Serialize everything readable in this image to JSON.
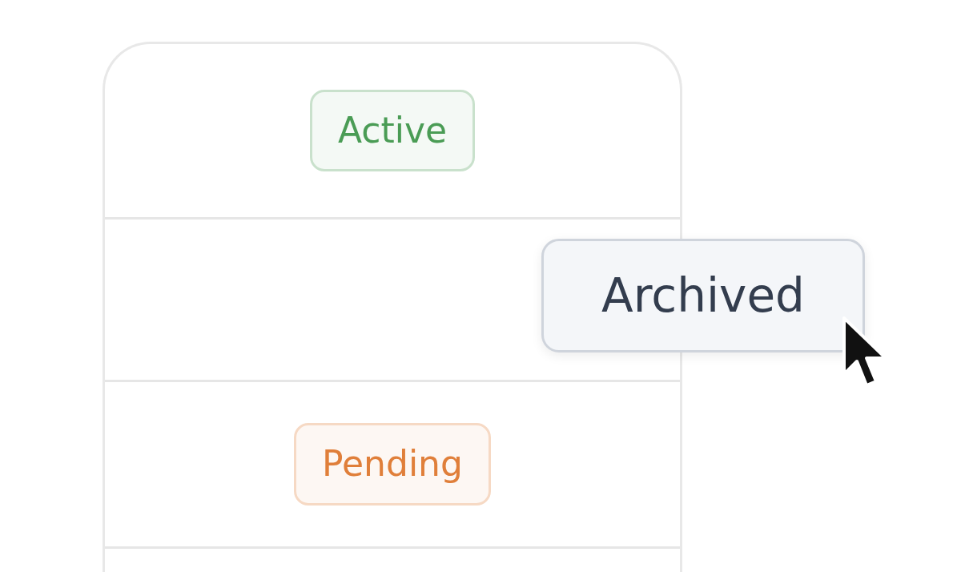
{
  "table": {
    "rows": [
      {
        "kind": "badge",
        "label": "Active",
        "color": "#4a9c55"
      },
      {
        "kind": "empty"
      },
      {
        "kind": "badge",
        "label": "Pending",
        "color": "#e07f3a"
      },
      {
        "kind": "empty"
      }
    ]
  },
  "dragged_badge": {
    "label": "Archived"
  }
}
